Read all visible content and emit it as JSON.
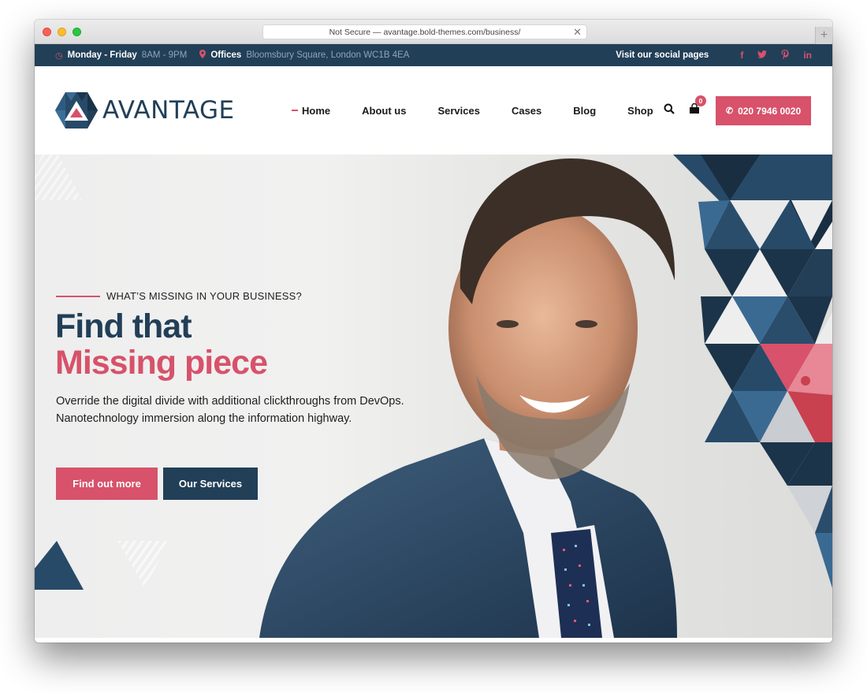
{
  "browser": {
    "url_text": "Not Secure — avantage.bold-themes.com/business/",
    "close_glyph": "✕",
    "new_tab_glyph": "+"
  },
  "topbar": {
    "hours_label": "Monday - Friday",
    "hours_value": "8AM - 9PM",
    "offices_label": "Offices",
    "offices_value": "Bloomsbury Square, London WC1B 4EA",
    "social_label": "Visit our social pages",
    "social": [
      {
        "name": "facebook",
        "glyph": "f"
      },
      {
        "name": "twitter",
        "glyph": "t"
      },
      {
        "name": "pinterest",
        "glyph": "p"
      },
      {
        "name": "linkedin",
        "glyph": "in"
      }
    ],
    "clock_glyph": "◷",
    "pin_glyph": "⚲"
  },
  "header": {
    "logo_text": "AVANTAGE",
    "nav": [
      {
        "label": "Home",
        "active": true
      },
      {
        "label": "About us"
      },
      {
        "label": "Services"
      },
      {
        "label": "Cases"
      },
      {
        "label": "Blog"
      },
      {
        "label": "Shop"
      }
    ],
    "cart_count": "0",
    "phone_glyph": "✆",
    "phone_number": "020 7946 0020"
  },
  "hero": {
    "eyebrow": "WHAT’S MISSING IN YOUR BUSINESS?",
    "title_line1": "Find that",
    "title_line2": "Missing piece",
    "lead_line1": "Override the digital divide with additional clickthroughs from DevOps.",
    "lead_line2": "Nanotechnology immersion along the information highway.",
    "primary_button": "Find out more",
    "secondary_button": "Our Services"
  },
  "colors": {
    "navy": "#223f58",
    "accent_red": "#d7526a",
    "white": "#ffffff"
  }
}
